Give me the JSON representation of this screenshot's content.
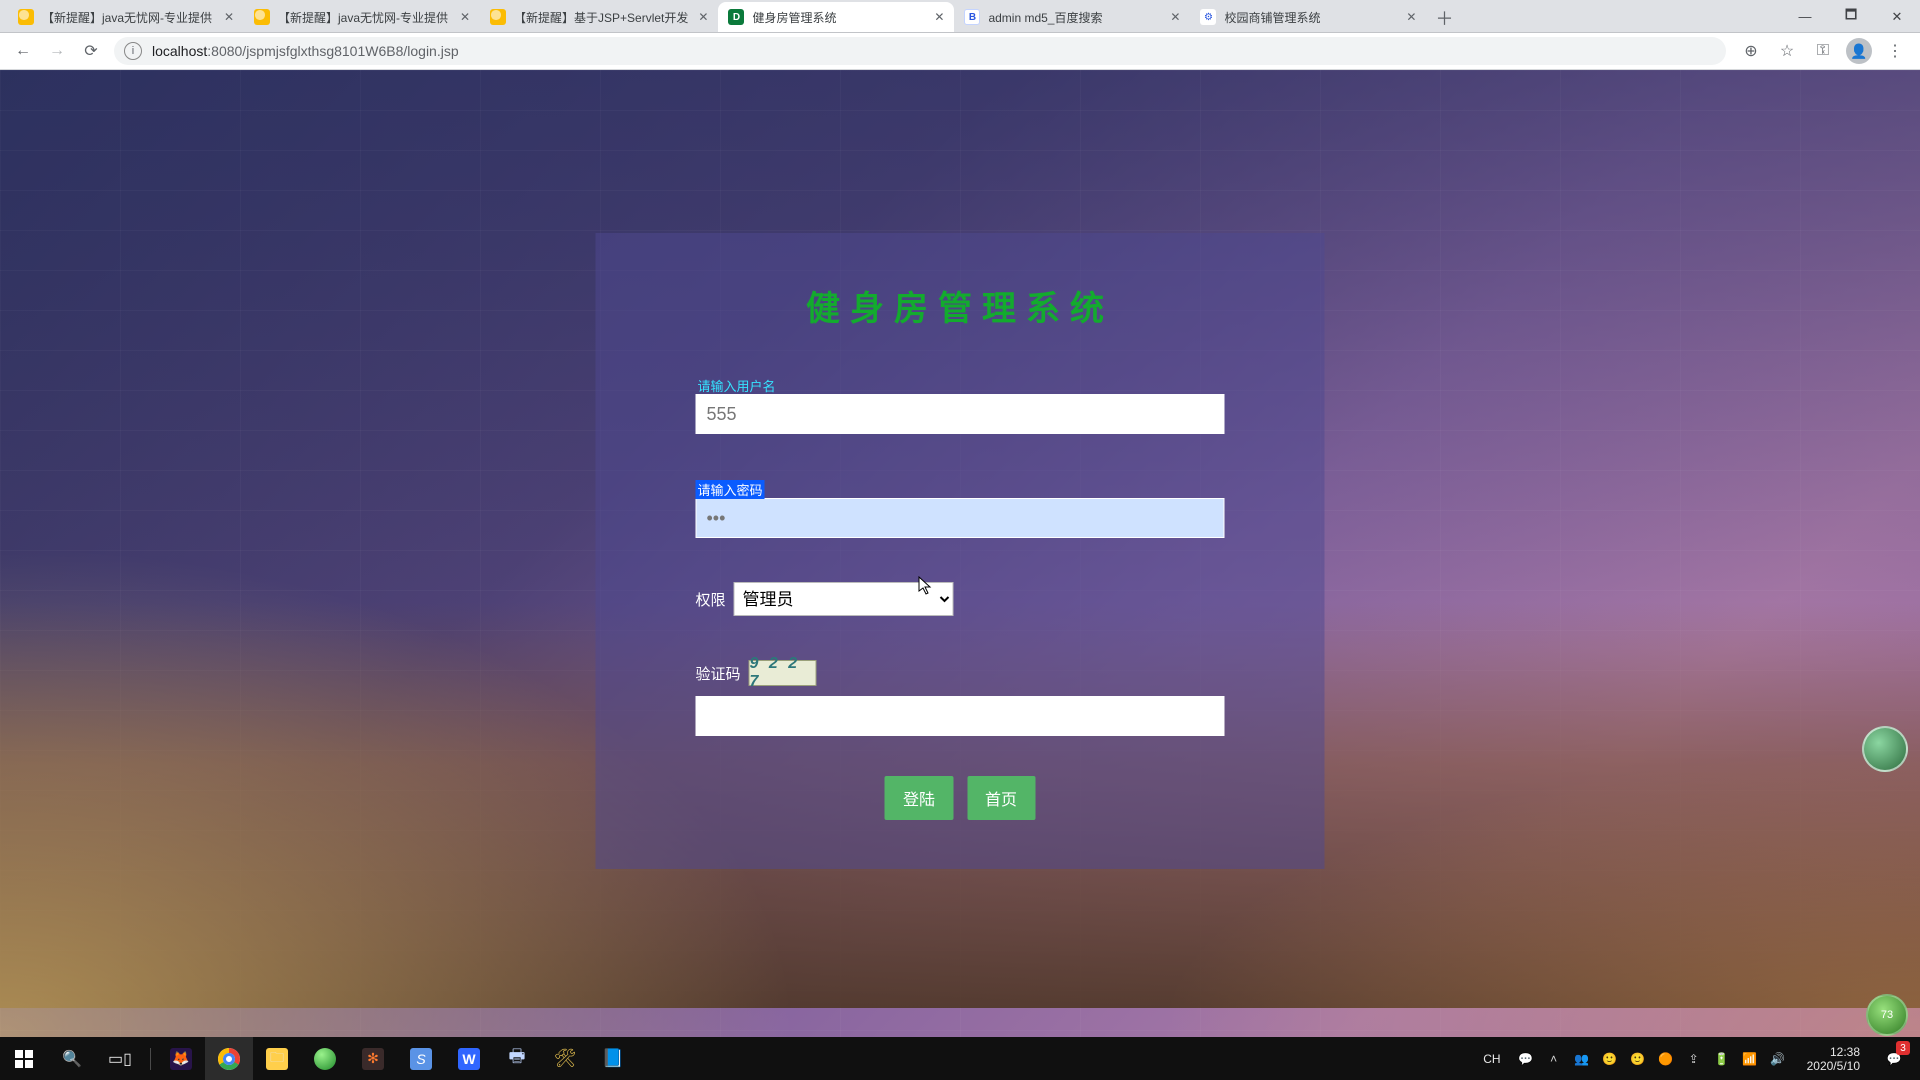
{
  "browser": {
    "tabs": [
      {
        "title": "【新提醒】java无忧网-专业提供",
        "active": false,
        "fav": "yellow"
      },
      {
        "title": "【新提醒】java无忧网-专业提供",
        "active": false,
        "fav": "yellow"
      },
      {
        "title": "【新提醒】基于JSP+Servlet开发",
        "active": false,
        "fav": "yellow"
      },
      {
        "title": "健身房管理系统",
        "active": true,
        "fav": "green"
      },
      {
        "title": "admin md5_百度搜索",
        "active": false,
        "fav": "baidu"
      },
      {
        "title": "校园商铺管理系统",
        "active": false,
        "fav": "gear"
      }
    ],
    "url_host": "localhost",
    "url_port_path": ":8080/jspmjsfglxthsg8101W6B8/login.jsp"
  },
  "login": {
    "title": "健身房管理系统",
    "username_label": "请输入用户名",
    "username_value": "555",
    "password_label": "请输入密码",
    "password_value": "•••",
    "role_label": "权限",
    "role_value": "管理员",
    "captcha_label": "验证码",
    "captcha_image_text": "9 2 2 7",
    "captcha_value": "",
    "login_btn": "登陆",
    "home_btn": "首页"
  },
  "float_circle_text": "73",
  "taskbar": {
    "ime": "CH",
    "time": "12:38",
    "date": "2020/5/10",
    "notif_count": "3"
  }
}
